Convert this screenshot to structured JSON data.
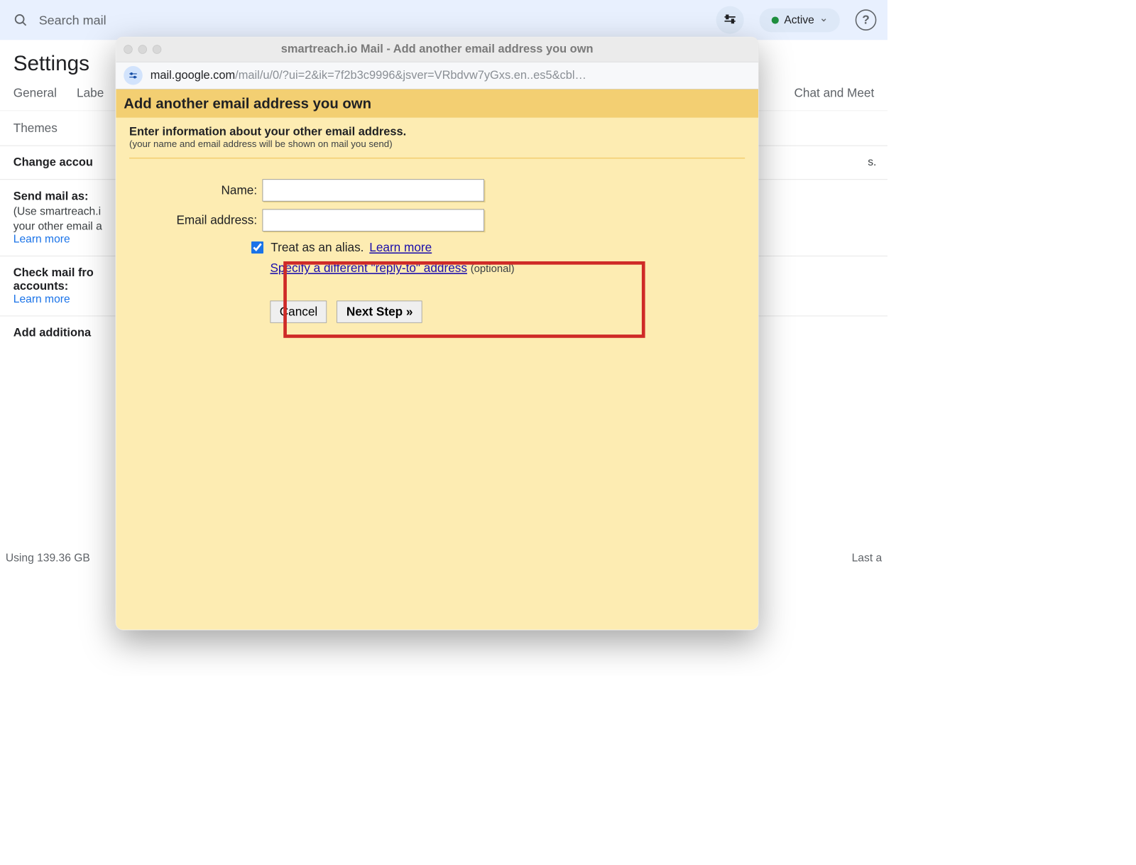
{
  "header": {
    "search_placeholder": "Search mail",
    "active_label": "Active"
  },
  "settings": {
    "title": "Settings",
    "tabs": {
      "general": "General",
      "labels": "Labe",
      "chat_meet": "Chat and Meet",
      "themes": "Themes"
    },
    "right_fragment": "s."
  },
  "sections": {
    "change_account": "Change accou",
    "send_as": {
      "head": "Send mail as:",
      "sub1": "(Use smartreach.i",
      "sub2": "your other email a",
      "learn": "Learn more"
    },
    "check_mail": {
      "head1": "Check mail fro",
      "head2": "accounts:",
      "learn": "Learn more"
    },
    "add_additional": "Add additiona"
  },
  "footer": {
    "left": "Using 139.36 GB",
    "right": "Last a"
  },
  "popup": {
    "window_title": "smartreach.io Mail - Add another email address you own",
    "url_host": "mail.google.com",
    "url_path": "/mail/u/0/?ui=2&ik=7f2b3c9996&jsver=VRbdvw7yGxs.en..es5&cbl…",
    "title": "Add another email address you own",
    "sub_title": "Enter information about your other email address.",
    "sub_note": "(your name and email address will be shown on mail you send)",
    "name_label": "Name:",
    "email_label": "Email address:",
    "name_value": "",
    "email_value": "",
    "alias_label": "Treat as an alias.",
    "alias_learn": "Learn more",
    "replyto_link": "Specify a different \"reply-to\" address",
    "replyto_opt": "(optional)",
    "cancel": "Cancel",
    "next": "Next Step »"
  }
}
